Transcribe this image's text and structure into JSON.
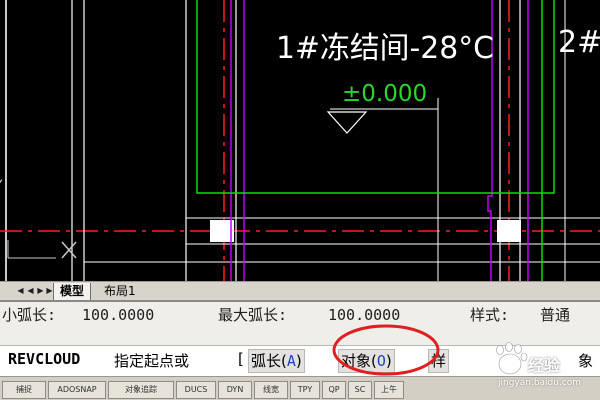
{
  "drawing": {
    "room_label": "1#冻结间-28°C",
    "room_label_next": "2#",
    "elevation_label": "±0.000",
    "axis_label": "Y",
    "colors": {
      "background": "#000000",
      "wall": "#ffffff",
      "room_outline": "#00e000",
      "axis": "#ff1e1e",
      "column": "#c000ff",
      "elevation": "#2bd52b"
    }
  },
  "tabs": [
    {
      "label": "模型",
      "active": true
    },
    {
      "label": "布局1",
      "active": false
    }
  ],
  "command": {
    "history": {
      "min_arc_label": "小弧长:",
      "min_arc_value": "100.0000",
      "max_arc_label": "最大弧长:",
      "max_arc_value": "100.0000",
      "style_label": "样式:",
      "style_value": "普通"
    },
    "prompt": {
      "command_name": "REVCLOUD",
      "text": "指定起点或",
      "bracket_open": "[",
      "options": [
        {
          "label": "弧长",
          "key": "A"
        },
        {
          "label": "对象",
          "key": "O"
        },
        {
          "label": "样",
          "key": ""
        }
      ],
      "trailing": "象"
    }
  },
  "status_bar": {
    "buttons": [
      "捕捉",
      "ADOSNAP",
      "对象追踪",
      "DUCS",
      "DYN",
      "线宽",
      "TPY",
      "QP",
      "SC",
      "上午"
    ]
  },
  "annotation": {
    "color": "#e02020"
  },
  "watermark": {
    "text": "经验",
    "url": "jingyan.baidu.com"
  }
}
